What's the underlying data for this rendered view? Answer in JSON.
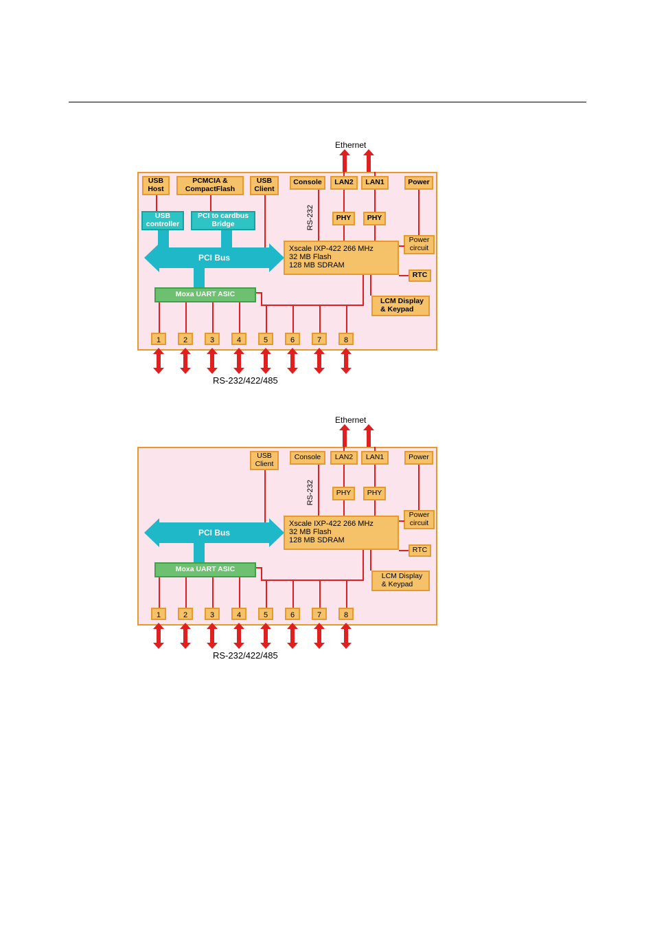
{
  "diagramTop": {
    "ethernet_label": "Ethernet",
    "top_boxes": {
      "usb_host": "USB\nHost",
      "pcmcia": "PCMCIA &\nCompactFlash",
      "usb_client": "USB\nClient",
      "console": "Console",
      "lan2": "LAN2",
      "lan1": "LAN1",
      "power": "Power"
    },
    "cyan_boxes": {
      "usb_controller": "USB\ncontroller",
      "pci_bridge": "PCI to cardbus\nBridge"
    },
    "pci_bus": "PCI Bus",
    "uart": "Moxa UART ASIC",
    "phy1": "PHY",
    "phy2": "PHY",
    "rs232_vert": "RS-232",
    "cpu": "Xscale IXP-422 266 MHz\n32 MB Flash\n128 MB SDRAM",
    "power_circuit": "Power\ncircuit",
    "rtc": "RTC",
    "lcm": "LCM Display\n& Keypad",
    "ports": [
      "1",
      "2",
      "3",
      "4",
      "5",
      "6",
      "7",
      "8"
    ],
    "bus_label": "RS-232/422/485"
  },
  "diagramBottom": {
    "ethernet_label": "Ethernet",
    "top_boxes": {
      "usb_client": "USB\nClient",
      "console": "Console",
      "lan2": "LAN2",
      "lan1": "LAN1",
      "power": "Power"
    },
    "pci_bus": "PCI Bus",
    "uart": "Moxa UART ASIC",
    "phy1": "PHY",
    "phy2": "PHY",
    "rs232_vert": "RS-232",
    "cpu": "Xscale IXP-422 266 MHz\n32 MB Flash\n128 MB SDRAM",
    "power_circuit": "Power\ncircuit",
    "rtc": "RTC",
    "lcm": "LCM Display\n& Keypad",
    "ports": [
      "1",
      "2",
      "3",
      "4",
      "5",
      "6",
      "7",
      "8"
    ],
    "bus_label": "RS-232/422/485"
  }
}
